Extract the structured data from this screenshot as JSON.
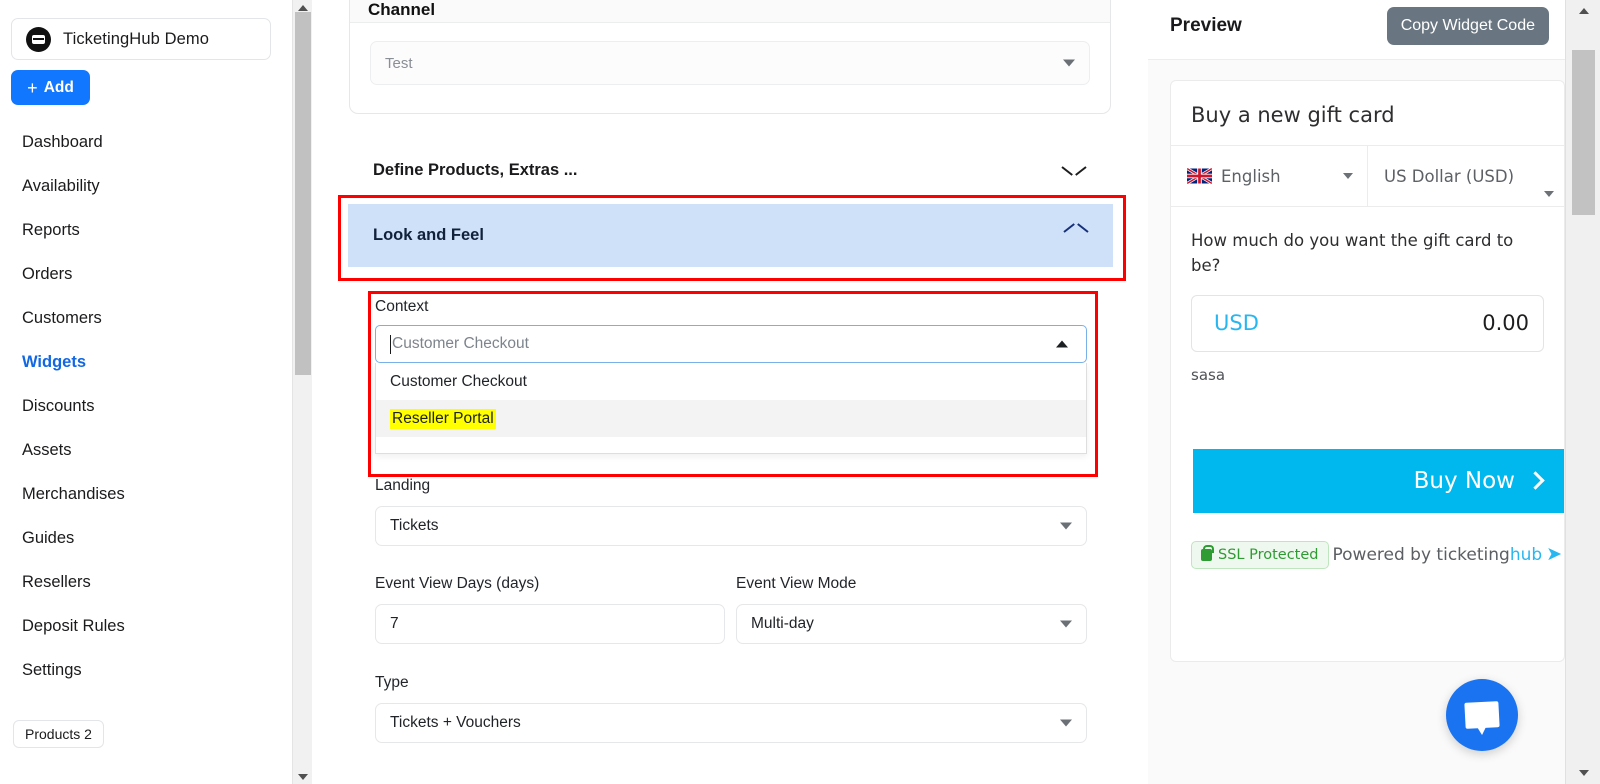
{
  "sidebar": {
    "brand": "TicketingHub Demo",
    "add_label": "Add",
    "items": [
      {
        "label": "Dashboard",
        "active": false
      },
      {
        "label": "Availability",
        "active": false
      },
      {
        "label": "Reports",
        "active": false
      },
      {
        "label": "Orders",
        "active": false
      },
      {
        "label": "Customers",
        "active": false
      },
      {
        "label": "Widgets",
        "active": true
      },
      {
        "label": "Discounts",
        "active": false
      },
      {
        "label": "Assets",
        "active": false
      },
      {
        "label": "Merchandises",
        "active": false
      },
      {
        "label": "Guides",
        "active": false
      },
      {
        "label": "Resellers",
        "active": false
      },
      {
        "label": "Deposit Rules",
        "active": false
      },
      {
        "label": "Settings",
        "active": false
      }
    ],
    "products_badge": "Products 2"
  },
  "main": {
    "channel_card": {
      "title": "Channel",
      "select_value": "Test"
    },
    "accordions": {
      "define": "Define Products, Extras ...",
      "look_and_feel": "Look and Feel"
    },
    "context": {
      "label": "Context",
      "value": "Customer Checkout",
      "options": [
        {
          "label": "Customer Checkout",
          "highlighted": false
        },
        {
          "label": "Reseller Portal",
          "highlighted": true
        }
      ]
    },
    "fields": {
      "landing_label": "Landing",
      "landing_value": "Tickets",
      "event_view_days_label": "Event View Days (days)",
      "event_view_days_value": "7",
      "event_view_mode_label": "Event View Mode",
      "event_view_mode_value": "Multi-day",
      "type_label": "Type",
      "type_value": "Tickets + Vouchers"
    }
  },
  "preview": {
    "title": "Preview",
    "copy_button": "Copy Widget Code",
    "widget": {
      "heading": "Buy a new gift card",
      "language": "English",
      "currency": "US Dollar (USD)",
      "question": "How much do you want the gift card to be?",
      "amount_currency": "USD",
      "amount_value": "0.00",
      "note": "sasa",
      "buy_button": "Buy Now",
      "ssl_badge": "SSL Protected",
      "powered_prefix": "Powered by ticketing",
      "powered_suffix": "hub"
    }
  },
  "colors": {
    "accent_blue": "#1177ff",
    "accordion_active_bg": "#cfe1f9",
    "annotation_red": "#ff0000",
    "highlight_yellow": "#ffff00",
    "widget_cyan": "#00b7ee",
    "ssl_green": "#2f9b33"
  }
}
